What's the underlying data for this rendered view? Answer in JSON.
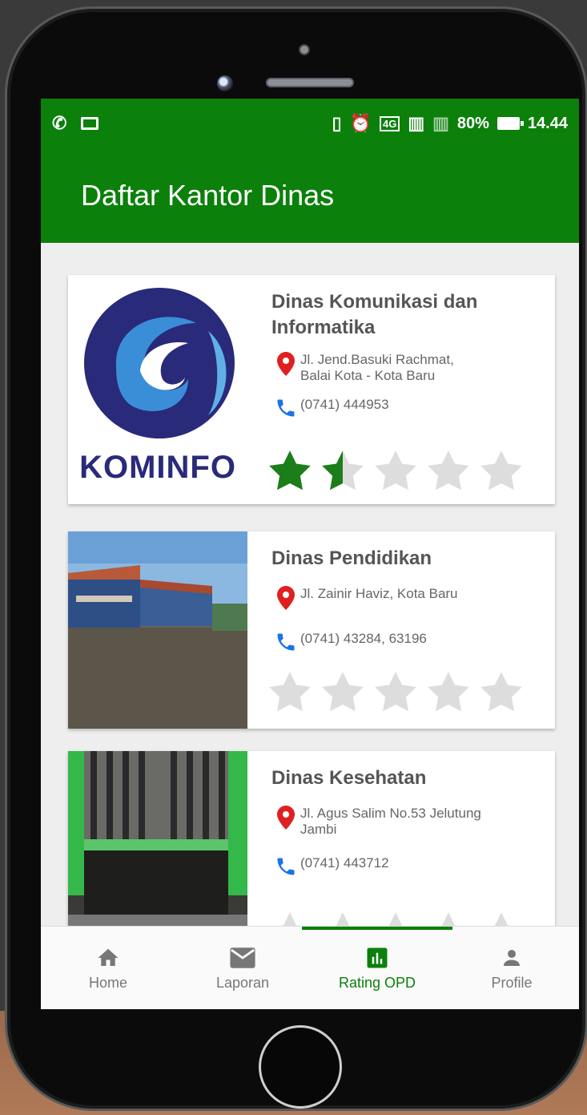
{
  "status_bar": {
    "battery": "80%",
    "time": "14.44"
  },
  "app_bar": {
    "title": "Daftar Kantor Dinas"
  },
  "cards": [
    {
      "title_line1": "Dinas Komunikasi dan",
      "title_line2": "Informatika",
      "address_line1": "Jl. Jend.Basuki Rachmat,",
      "address_line2": "Balai Kota - Kota Baru",
      "phone": "(0741) 444953",
      "rating": 1.5,
      "logo_text": "KOMINFO"
    },
    {
      "title_line1": "Dinas Pendidikan",
      "address_line1": "Jl. Zainir Haviz, Kota Baru",
      "phone": "(0741) 43284, 63196",
      "rating": 0
    },
    {
      "title_line1": "Dinas Kesehatan",
      "address_line1": "Jl. Agus Salim No.53 Jelutung",
      "address_line2": "Jambi",
      "phone": "(0741) 443712",
      "rating": 0
    }
  ],
  "bottom_nav": {
    "items": [
      {
        "label": "Home",
        "icon": "home-icon"
      },
      {
        "label": "Laporan",
        "icon": "mail-icon"
      },
      {
        "label": "Rating OPD",
        "icon": "chart-icon"
      },
      {
        "label": "Profile",
        "icon": "person-icon"
      }
    ],
    "active_index": 2
  },
  "colors": {
    "primary": "#0b800b",
    "star_filled": "#1b7e1b",
    "star_empty": "#dddddd",
    "pin": "#e02020",
    "phone_icon": "#1a73e8"
  }
}
